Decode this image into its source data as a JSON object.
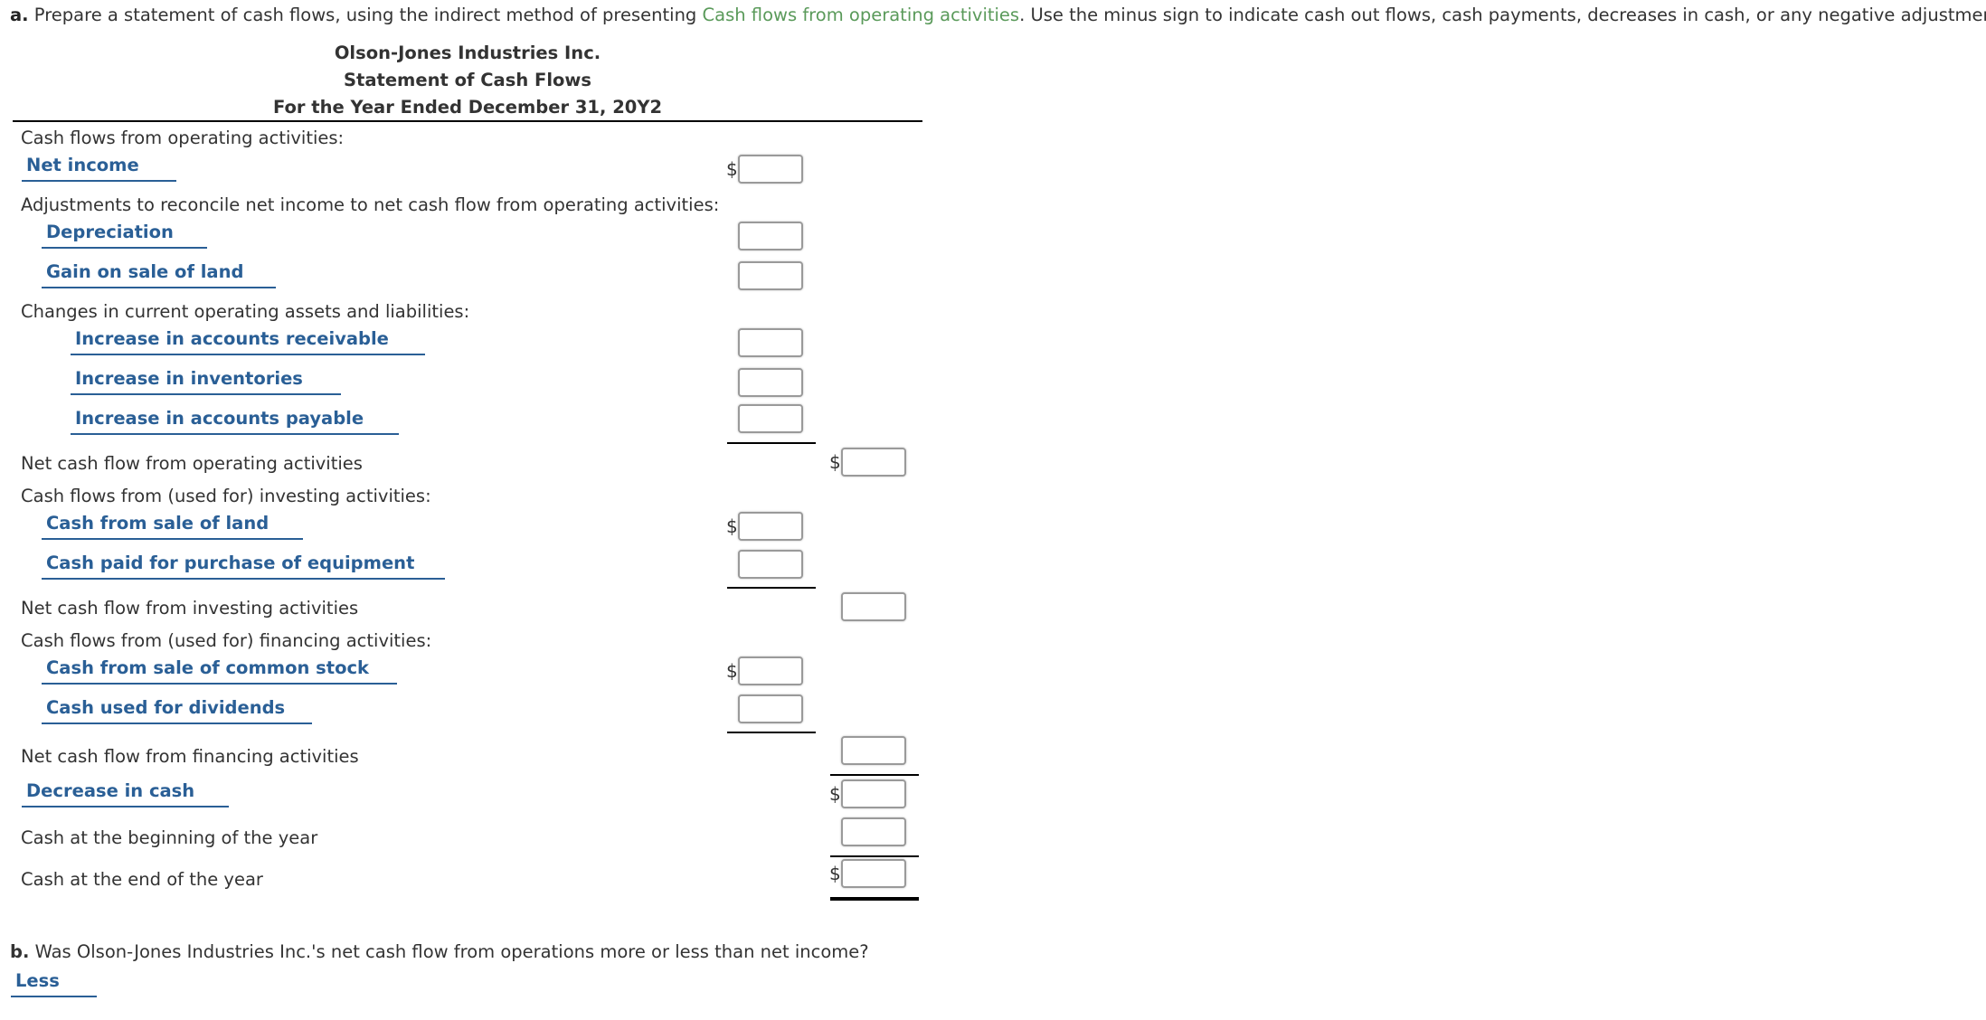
{
  "instruction": {
    "prefix": "a.",
    "text_before": " Prepare a statement of cash flows, using the indirect method of presenting ",
    "link_text": "Cash flows from operating activities",
    "text_after": ". Use the minus sign to indicate cash out flows, cash payments, decreases in cash, or any negative adjustment",
    "link_color": "#5a9a5a"
  },
  "statement": {
    "company": "Olson-Jones Industries Inc.",
    "title": "Statement of Cash Flows",
    "period": "For the Year Ended December 31, 20Y2"
  },
  "rows": {
    "operating_header": "Cash flows from operating activities:",
    "net_income": "Net income",
    "adjustments_header": "Adjustments to reconcile net income to net cash flow from operating activities:",
    "depreciation": "Depreciation",
    "gain_on_sale": "Gain on sale of land",
    "changes_header": "Changes in current operating assets and liabilities:",
    "increase_ar": "Increase in accounts receivable",
    "increase_inventories": "Increase in inventories",
    "increase_ap": "Increase in accounts payable",
    "net_operating": "Net cash flow from operating activities",
    "investing_header": "Cash flows from (used for) investing activities:",
    "cash_sale_land": "Cash from sale of land",
    "cash_purchase_equipment": "Cash paid for purchase of equipment",
    "net_investing": "Net cash flow from investing activities",
    "financing_header": "Cash flows from (used for) financing activities:",
    "cash_sale_stock": "Cash from sale of common stock",
    "cash_dividends": "Cash used for dividends",
    "net_financing": "Net cash flow from financing activities",
    "decrease_cash": "Decrease in cash",
    "cash_beginning": "Cash at the beginning of the year",
    "cash_end": "Cash at the end of the year"
  },
  "currency_symbol": "$",
  "inputs": {
    "net_income": "",
    "depreciation": "",
    "gain_on_sale": "",
    "increase_ar": "",
    "increase_inventories": "",
    "increase_ap": "",
    "net_operating": "",
    "cash_sale_land": "",
    "cash_purchase_equipment": "",
    "net_investing": "",
    "cash_sale_stock": "",
    "cash_dividends": "",
    "net_financing": "",
    "decrease_cash": "",
    "cash_beginning": "",
    "cash_end": ""
  },
  "question_b": {
    "prefix": "b.",
    "text": " Was Olson-Jones Industries Inc.'s net cash flow from operations more or less than net income?",
    "answer": "Less"
  },
  "colors": {
    "select_blue": "#2a5f96",
    "text": "#333333"
  }
}
